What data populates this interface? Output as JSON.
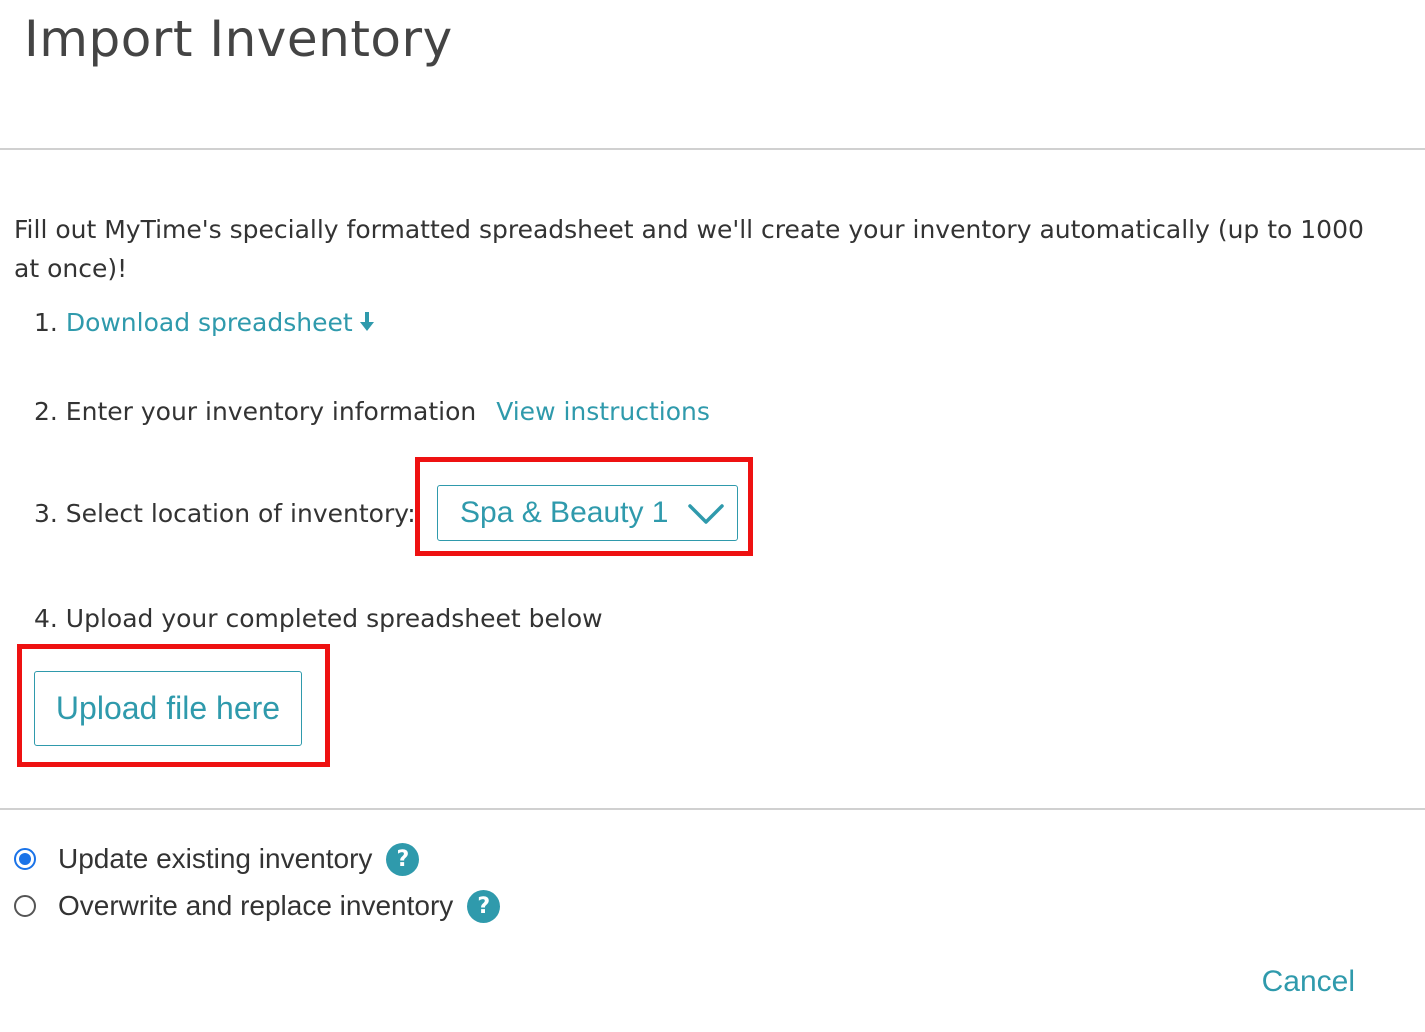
{
  "header": {
    "title": "Import Inventory"
  },
  "intro": {
    "text": "Fill out MyTime's specially formatted spreadsheet and we'll create your inventory automatically (up to 1000 at once)!"
  },
  "steps": {
    "step1": {
      "number": "1.",
      "link_label": "Download spreadsheet",
      "icon": "download-arrow-icon"
    },
    "step2": {
      "label": "2. Enter your inventory information",
      "link_label": "View instructions"
    },
    "step3": {
      "label": "3. Select location of inventory:",
      "selected_location": "Spa & Beauty 1",
      "icon": "chevron-down-icon"
    },
    "step4": {
      "label": "4. Upload your completed spreadsheet below",
      "upload_label": "Upload file here"
    }
  },
  "options": [
    {
      "label": "Update existing inventory",
      "checked": true,
      "help": "?"
    },
    {
      "label": "Overwrite and replace inventory",
      "checked": false,
      "help": "?"
    }
  ],
  "footer": {
    "cancel_label": "Cancel"
  },
  "colors": {
    "accent": "#2f9aac",
    "highlight": "#ee1111",
    "radio_checked": "#1a73e8"
  }
}
